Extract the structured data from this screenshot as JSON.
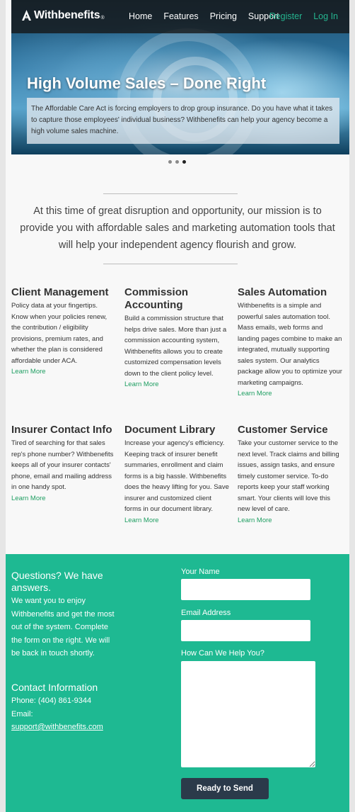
{
  "brand": {
    "name": "Withbenefits",
    "reg": "®"
  },
  "nav": {
    "items": [
      "Home",
      "Features",
      "Pricing",
      "Support"
    ],
    "register": "Register",
    "login": "Log In"
  },
  "hero": {
    "title": "High Volume Sales – Done Right",
    "text": "The Affordable Care Act is forcing employers to drop group insurance. Do you have what it takes to capture those employees' individual business? Withbenefits can help your agency become a high volume sales machine."
  },
  "carousel": {
    "count": 3,
    "active": 3
  },
  "mission": "At this time of great disruption and opportunity, our mission is to provide you with affordable sales and marketing automation tools that will help your independent agency flourish and grow.",
  "features": [
    {
      "title": "Client Management",
      "text": "Policy data at your fingertips. Know when your policies renew, the contribution / eligibility provisions, premium rates, and whether the plan is considered affordable under ACA.",
      "link": "Learn More"
    },
    {
      "title": "Commission Accounting",
      "text": "Build a commission structure that helps drive sales. More than just a commission accounting system, Withbenefits allows you to create customized compensation levels down to the client policy level.",
      "link": "Learn More"
    },
    {
      "title": "Sales Automation",
      "text": "Withbenefits is a simple and powerful sales automation tool. Mass emails, web forms and landing pages combine to make an integrated, mutually supporting sales system. Our analytics package allow you to optimize your marketing campaigns.",
      "link": "Learn More"
    },
    {
      "title": "Insurer Contact Info",
      "text": "Tired of searching for that sales rep's phone number? Withbenefits keeps all of your insurer contacts' phone, email and mailing address in one handy spot.",
      "link": "Learn More"
    },
    {
      "title": "Document Library",
      "text": "Increase your agency's efficiency. Keeping track of insurer benefit summaries, enrollment and claim forms is a big hassle. Withbenefits does the heavy lifting for you. Save insurer and customized client forms in our document library.",
      "link": "Learn More"
    },
    {
      "title": "Customer Service",
      "text": "Take your customer service to the next level. Track claims and billing issues, assign tasks, and ensure timely customer service. To-do reports keep your staff working smart. Your clients will love this new level of care.",
      "link": "Learn More"
    }
  ],
  "contact": {
    "heading": "Questions? We have answers.",
    "text": "We want you to enjoy Withbenefits and get the most out of the system. Complete the form on the right. We will be back in touch shortly.",
    "info_heading": "Contact Information",
    "phone": "Phone: (404) 861-9344",
    "email_label": "Email:",
    "email": "support@withbenefits.com"
  },
  "form": {
    "name_label": "Your Name",
    "email_label": "Email Address",
    "help_label": "How Can We Help You?",
    "name_value": "",
    "email_value": "",
    "help_value": "",
    "submit": "Ready to Send"
  },
  "colors": {
    "accent": "#1eb992",
    "link": "#1f9e62",
    "nav_accent": "#25b58f",
    "button": "#2b3a4a"
  }
}
